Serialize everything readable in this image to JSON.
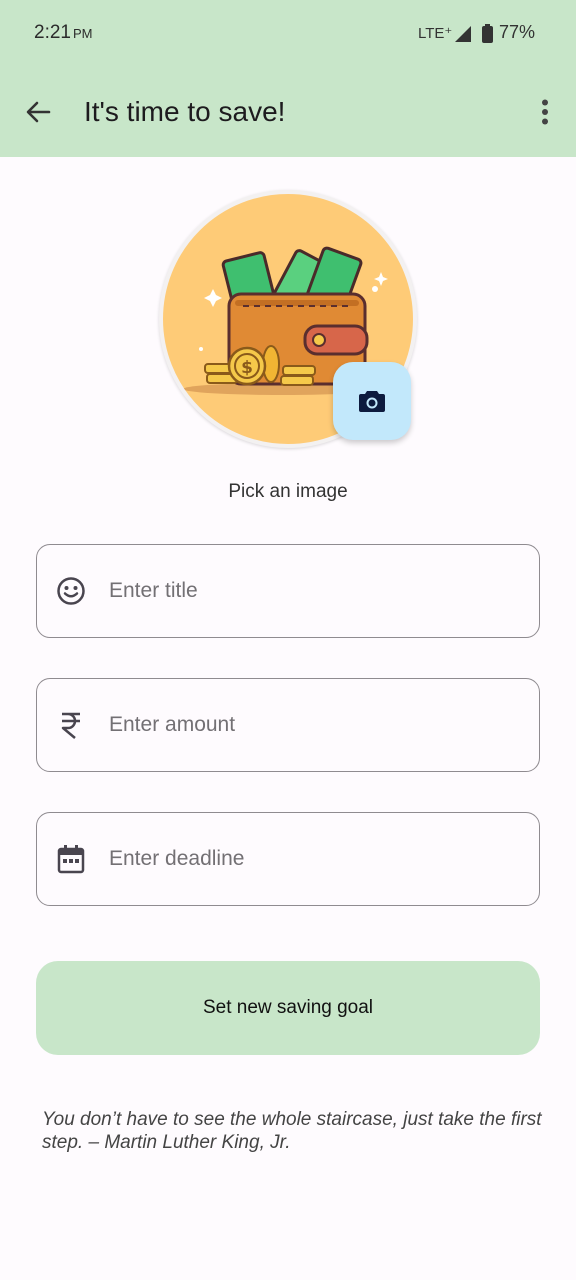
{
  "status_bar": {
    "time": "2:21",
    "ampm": "PM",
    "network": "LTE⁺",
    "battery": "77%"
  },
  "app_bar": {
    "title": "It's time to save!",
    "back_icon": "arrow-back-icon",
    "menu_icon": "more-vert-icon"
  },
  "image_picker": {
    "label": "Pick an image",
    "camera_icon": "camera-icon"
  },
  "form": {
    "title_field": {
      "placeholder": "Enter title",
      "value": "",
      "icon": "smiley-icon"
    },
    "amount_field": {
      "placeholder": "Enter amount",
      "value": "",
      "icon": "rupee-icon"
    },
    "deadline_field": {
      "placeholder": "Enter deadline",
      "value": "",
      "icon": "calendar-icon"
    },
    "submit_label": "Set new saving goal"
  },
  "quote": "You don’t have to see the whole staircase, just take the first step. – Martin Luther King, Jr.",
  "colors": {
    "app_bar": "#c8e6c9",
    "button": "#c8e6c9",
    "camera_button": "#c2e8fb",
    "image_bg": "#fecb77"
  }
}
